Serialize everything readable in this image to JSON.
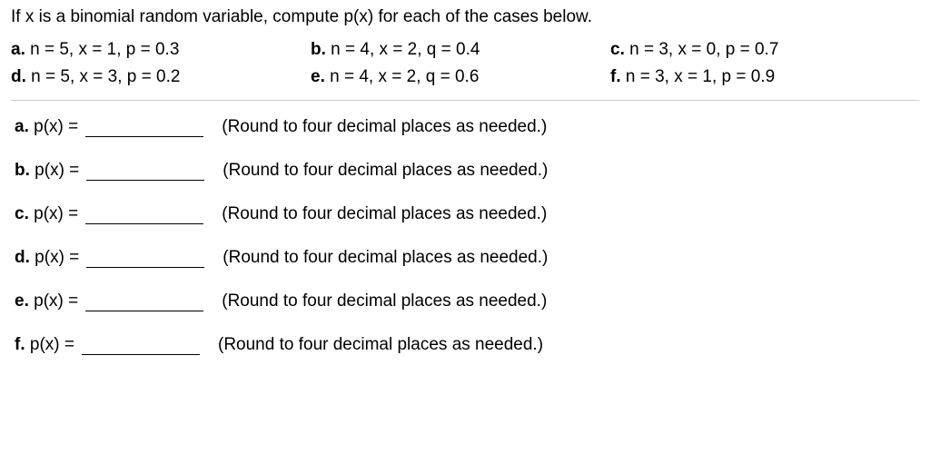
{
  "intro": "If x is a binomial random variable, compute p(x) for each of the cases below.",
  "cases": {
    "a": {
      "letter": "a.",
      "text": "n = 5, x = 1, p = 0.3"
    },
    "b": {
      "letter": "b.",
      "text": "n = 4, x = 2, q = 0.4"
    },
    "c": {
      "letter": "c.",
      "text": "n = 3, x = 0, p = 0.7"
    },
    "d": {
      "letter": "d.",
      "text": "n = 5, x = 3, p = 0.2"
    },
    "e": {
      "letter": "e.",
      "text": "n = 4, x = 2, q = 0.6"
    },
    "f": {
      "letter": "f.",
      "text": "n = 3, x = 1, p = 0.9"
    }
  },
  "answers": {
    "a": {
      "letter": "a.",
      "label": "p(x) =",
      "hint": "(Round to four decimal places as needed.)"
    },
    "b": {
      "letter": "b.",
      "label": "p(x) =",
      "hint": "(Round to four decimal places as needed.)"
    },
    "c": {
      "letter": "c.",
      "label": "p(x) =",
      "hint": "(Round to four decimal places as needed.)"
    },
    "d": {
      "letter": "d.",
      "label": "p(x) =",
      "hint": "(Round to four decimal places as needed.)"
    },
    "e": {
      "letter": "e.",
      "label": "p(x) =",
      "hint": "(Round to four decimal places as needed.)"
    },
    "f": {
      "letter": "f.",
      "label": "p(x) =",
      "hint": "(Round to four decimal places as needed.)"
    }
  }
}
